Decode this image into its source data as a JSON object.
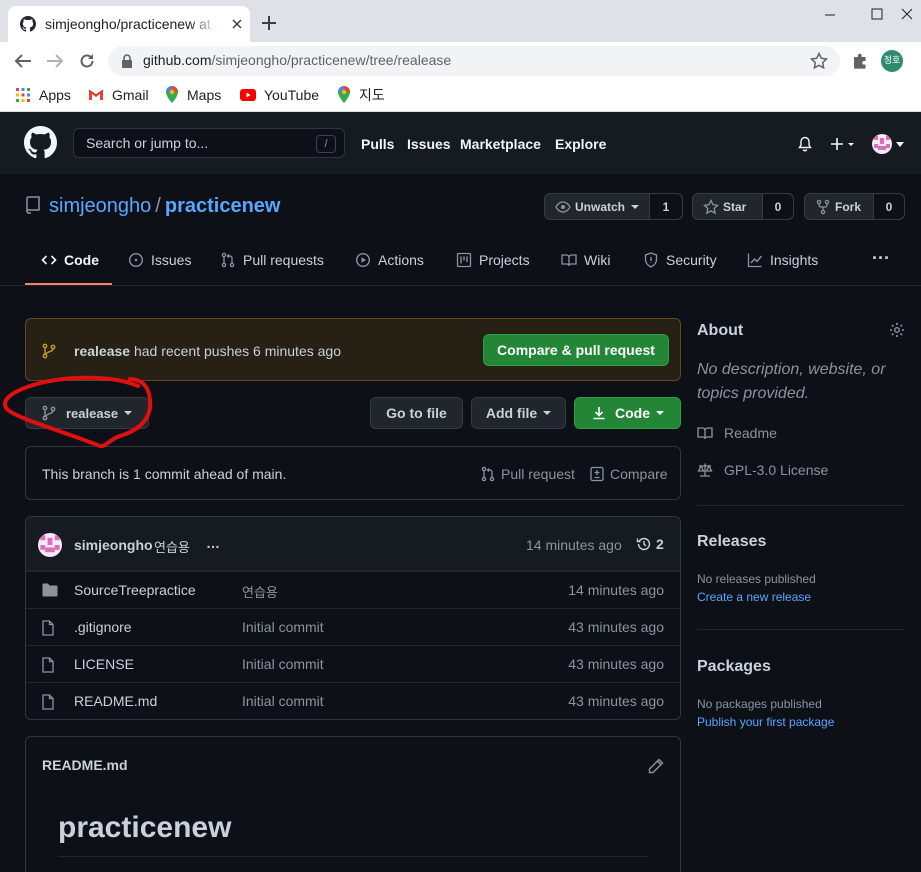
{
  "browser": {
    "tab_title": "simjeongho/practicenew at realease",
    "url_host": "github.com",
    "url_path": "/simjeongho/practicenew/tree/realease",
    "profile_initials": "정호",
    "bookmarks": [
      {
        "label": "Apps",
        "icon": "apps-grid-icon"
      },
      {
        "label": "Gmail",
        "icon": "gmail-icon"
      },
      {
        "label": "Maps",
        "icon": "maps-pin-icon"
      },
      {
        "label": "YouTube",
        "icon": "youtube-icon"
      },
      {
        "label": "지도",
        "icon": "maps-pin-icon"
      }
    ]
  },
  "github": {
    "search_placeholder": "Search or jump to...",
    "search_key": "/",
    "nav": [
      "Pulls",
      "Issues",
      "Marketplace",
      "Explore"
    ]
  },
  "repo": {
    "owner": "simjeongho",
    "separator": "/",
    "name": "practicenew",
    "watch": {
      "label": "Unwatch",
      "count": "1"
    },
    "star": {
      "label": "Star",
      "count": "0"
    },
    "fork": {
      "label": "Fork",
      "count": "0"
    },
    "tabs": [
      "Code",
      "Issues",
      "Pull requests",
      "Actions",
      "Projects",
      "Wiki",
      "Security",
      "Insights"
    ],
    "active_tab": "Code",
    "more": "···"
  },
  "banner": {
    "branch": "realease",
    "text": " had recent pushes 6 minutes ago",
    "button": "Compare & pull request"
  },
  "branch_bar": {
    "branch": "realease",
    "go_to_file": "Go to file",
    "add_file": "Add file",
    "code": "Code"
  },
  "ahead": {
    "text": "This branch is 1 commit ahead of main.",
    "pull_request": "Pull request",
    "compare": "Compare"
  },
  "latest_commit": {
    "author": "simjeongho",
    "message": "연습용",
    "more": "…",
    "time": "14 minutes ago",
    "count": "2"
  },
  "files": [
    {
      "type": "dir",
      "name": "SourceTreepractice",
      "message": "연습용",
      "time": "14 minutes ago"
    },
    {
      "type": "file",
      "name": ".gitignore",
      "message": "Initial commit",
      "time": "43 minutes ago"
    },
    {
      "type": "file",
      "name": "LICENSE",
      "message": "Initial commit",
      "time": "43 minutes ago"
    },
    {
      "type": "file",
      "name": "README.md",
      "message": "Initial commit",
      "time": "43 minutes ago"
    }
  ],
  "readme": {
    "title": "README.md",
    "heading": "practicenew"
  },
  "sidebar": {
    "about": "About",
    "description": "No description, website, or topics provided.",
    "readme": "Readme",
    "license": "GPL-3.0 License",
    "releases": "Releases",
    "no_releases": "No releases published",
    "create_release": "Create a new release",
    "packages": "Packages",
    "no_packages": "No packages published",
    "publish_package": "Publish your first package"
  },
  "colors": {
    "bg": "#0d1117",
    "header": "#161b22",
    "accent_link": "#58a6ff",
    "green_button": "#238636",
    "tab_underline": "#f78166",
    "annotation": "#e01010"
  }
}
